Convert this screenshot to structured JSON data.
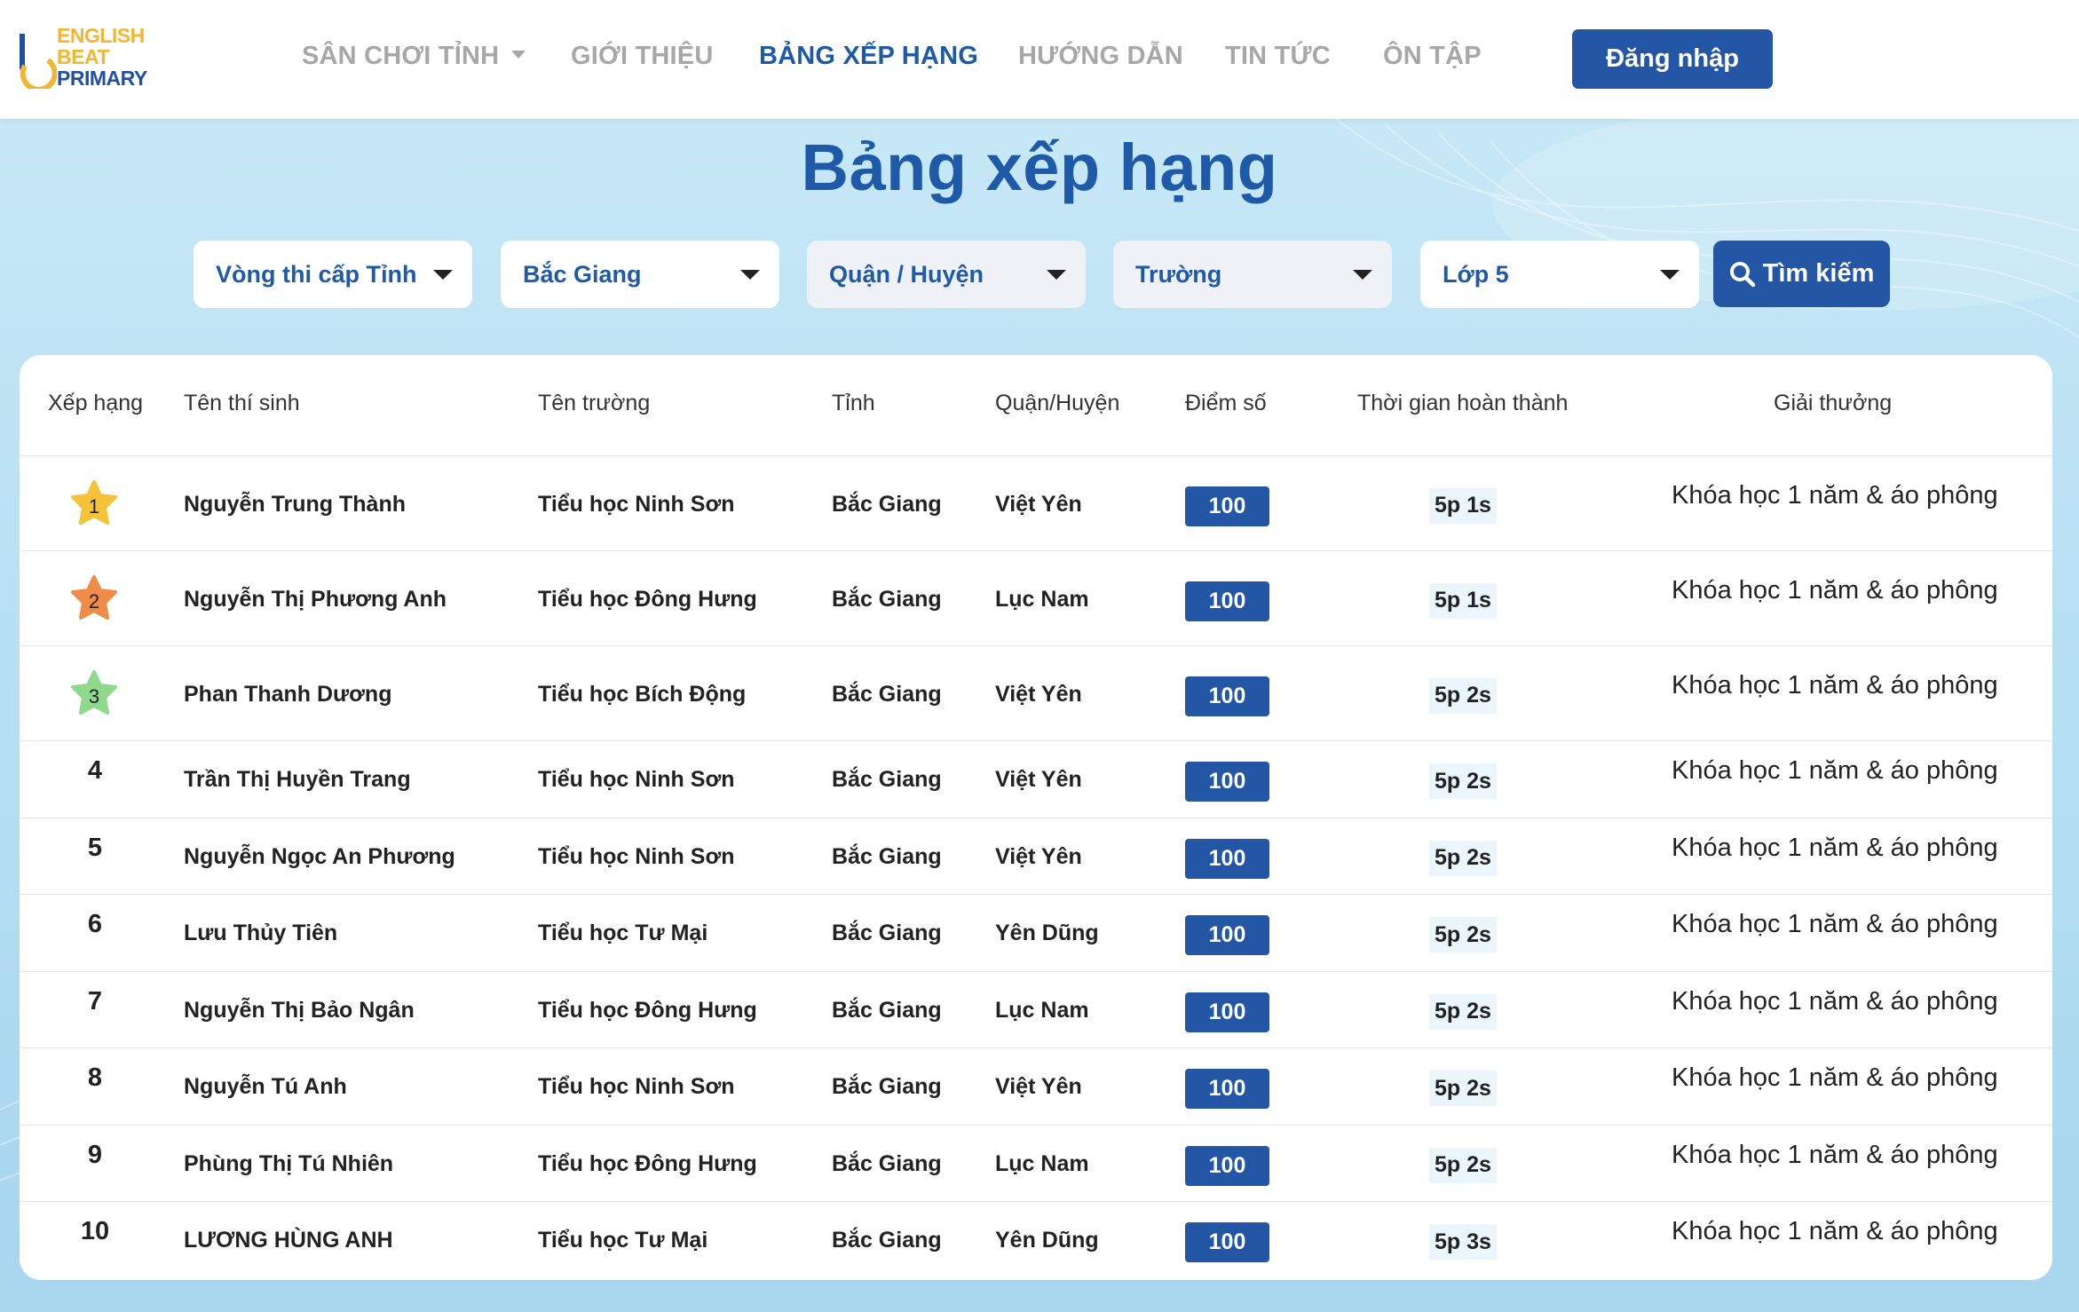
{
  "header": {
    "logo": {
      "line1": "ENGLISH",
      "line2": "BEAT",
      "line3": "PRIMARY"
    },
    "nav": [
      {
        "label": "SÂN CHƠI TỈNH",
        "has_dropdown": true,
        "active": false
      },
      {
        "label": "GIỚI THIỆU",
        "active": false
      },
      {
        "label": "BẢNG XẾP HẠNG",
        "active": true
      },
      {
        "label": "HƯỚNG DẪN",
        "active": false
      },
      {
        "label": "TIN TỨC",
        "active": false
      },
      {
        "label": "ÔN TẬP",
        "active": false
      }
    ],
    "login_label": "Đăng nhập"
  },
  "page_title": "Bảng xếp hạng",
  "filters": [
    {
      "label": "Vòng thi cấp Tỉnh",
      "style": "white"
    },
    {
      "label": "Bắc Giang",
      "style": "white"
    },
    {
      "label": "Quận / Huyện",
      "style": "grey"
    },
    {
      "label": "Trường",
      "style": "grey"
    },
    {
      "label": "Lớp 5",
      "style": "white"
    }
  ],
  "search_label": "Tìm kiếm",
  "table": {
    "headers": [
      "Xếp hạng",
      "Tên thí sinh",
      "Tên trường",
      "Tỉnh",
      "Quận/Huyện",
      "Điểm số",
      "Thời gian hoàn thành",
      "Giải thưởng"
    ],
    "rows": [
      {
        "rank": "1",
        "name": "Nguyễn Trung Thành",
        "school": "Tiểu học Ninh Sơn",
        "province": "Bắc Giang",
        "district": "Việt Yên",
        "score": "100",
        "time": "5p 1s",
        "prize": "Khóa học 1 năm & áo phông"
      },
      {
        "rank": "2",
        "name": "Nguyễn Thị Phương Anh",
        "school": "Tiểu học Đông Hưng",
        "province": "Bắc Giang",
        "district": "Lục Nam",
        "score": "100",
        "time": "5p 1s",
        "prize": "Khóa học 1 năm & áo phông"
      },
      {
        "rank": "3",
        "name": "Phan Thanh Dương",
        "school": "Tiểu học Bích Động",
        "province": "Bắc Giang",
        "district": "Việt Yên",
        "score": "100",
        "time": "5p 2s",
        "prize": "Khóa học 1 năm & áo phông"
      },
      {
        "rank": "4",
        "name": "Trần Thị Huyền Trang",
        "school": "Tiểu học Ninh Sơn",
        "province": "Bắc Giang",
        "district": "Việt Yên",
        "score": "100",
        "time": "5p 2s",
        "prize": "Khóa học 1 năm & áo phông"
      },
      {
        "rank": "5",
        "name": "Nguyễn Ngọc An Phương",
        "school": "Tiểu học Ninh Sơn",
        "province": "Bắc Giang",
        "district": "Việt Yên",
        "score": "100",
        "time": "5p 2s",
        "prize": "Khóa học 1 năm & áo phông"
      },
      {
        "rank": "6",
        "name": "Lưu Thủy Tiên",
        "school": "Tiểu học Tư Mại",
        "province": "Bắc Giang",
        "district": "Yên Dũng",
        "score": "100",
        "time": "5p 2s",
        "prize": "Khóa học 1 năm & áo phông"
      },
      {
        "rank": "7",
        "name": "Nguyễn Thị Bảo Ngân",
        "school": "Tiểu học Đông Hưng",
        "province": "Bắc Giang",
        "district": "Lục Nam",
        "score": "100",
        "time": "5p 2s",
        "prize": "Khóa học 1 năm & áo phông"
      },
      {
        "rank": "8",
        "name": "Nguyễn Tú Anh",
        "school": "Tiểu học Ninh Sơn",
        "province": "Bắc Giang",
        "district": "Việt Yên",
        "score": "100",
        "time": "5p 2s",
        "prize": "Khóa học 1 năm & áo phông"
      },
      {
        "rank": "9",
        "name": "Phùng Thị Tú Nhiên",
        "school": "Tiểu học Đông Hưng",
        "province": "Bắc Giang",
        "district": "Lục Nam",
        "score": "100",
        "time": "5p 2s",
        "prize": "Khóa học 1 năm & áo phông"
      },
      {
        "rank": "10",
        "name": "LƯƠNG HÙNG ANH",
        "school": "Tiểu học Tư Mại",
        "province": "Bắc Giang",
        "district": "Yên Dũng",
        "score": "100",
        "time": "5p 3s",
        "prize": "Khóa học 1 năm & áo phông"
      }
    ]
  },
  "colors": {
    "brand_blue": "#2456a6",
    "title_blue": "#1f5aa8",
    "nav_grey": "#a7a7a7",
    "logo_yellow": "#f2b632",
    "star_gold": "#f5c23a",
    "star_orange": "#ef8d48",
    "star_green": "#8fd98d"
  },
  "icons": {
    "rank1": "star-gold-icon",
    "rank2": "star-orange-icon",
    "rank3": "star-green-icon",
    "search": "magnifier-icon",
    "dropdown": "caret-down-icon"
  }
}
